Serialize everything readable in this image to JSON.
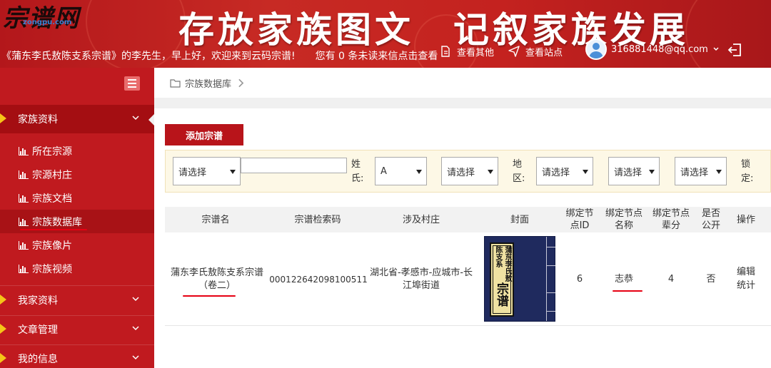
{
  "header": {
    "logo": "宗谱网",
    "logo_sub": "zongpu.com",
    "slogan": "存放家族图文　记叙家族发展",
    "welcome": "《蒲东李氏敖陈支系宗谱》的李先生，早上好，欢迎来到云码宗谱!　　您有 0 条未读来信点击查看",
    "links": [
      "查看其他",
      "查看站点"
    ],
    "user_email": "316881448@qq.com"
  },
  "sidebar": {
    "groups": [
      {
        "label": "家族资料",
        "active": true
      },
      {
        "label": "我家资料"
      },
      {
        "label": "文章管理"
      },
      {
        "label": "我的信息"
      }
    ],
    "items": [
      {
        "label": "所在宗源"
      },
      {
        "label": "宗源村庄"
      },
      {
        "label": "宗族文档"
      },
      {
        "label": "宗族数据库",
        "active": true
      },
      {
        "label": "宗族像片"
      },
      {
        "label": "宗族视频"
      }
    ]
  },
  "breadcrumb": "宗族数据库",
  "toolbar": {
    "add_label": "添加宗谱"
  },
  "filters": {
    "select1": "请选择",
    "text_value": "",
    "surname_label": "姓氏:",
    "surname_value": "A",
    "select2": "请选择",
    "region_label": "地区:",
    "select3": "请选择",
    "select4": "请选择",
    "select5": "请选择",
    "lock_label": "锁定:"
  },
  "table": {
    "headers": [
      "宗谱名",
      "宗谱检索码",
      "涉及村庄",
      "封面",
      "绑定节点ID",
      "绑定节点名称",
      "绑定节点辈分",
      "是否公开",
      "操作"
    ],
    "rows": [
      {
        "name": "蒲东李氏敖陈支系宗谱（卷二）",
        "code": "000122642098100511",
        "village": "湖北省-孝感市-应城市-长江埠街道",
        "cover_title": "蒲东李氏敖陈支系",
        "cover_big": "宗谱",
        "node_id": "6",
        "node_name": "志恭",
        "node_gen": "4",
        "public": "否",
        "ops": [
          "编辑",
          "统计"
        ]
      }
    ]
  },
  "colors": {
    "brand_red": "#c01a1f",
    "accent_gold": "#f5c518",
    "underline_red": "#e60012"
  }
}
